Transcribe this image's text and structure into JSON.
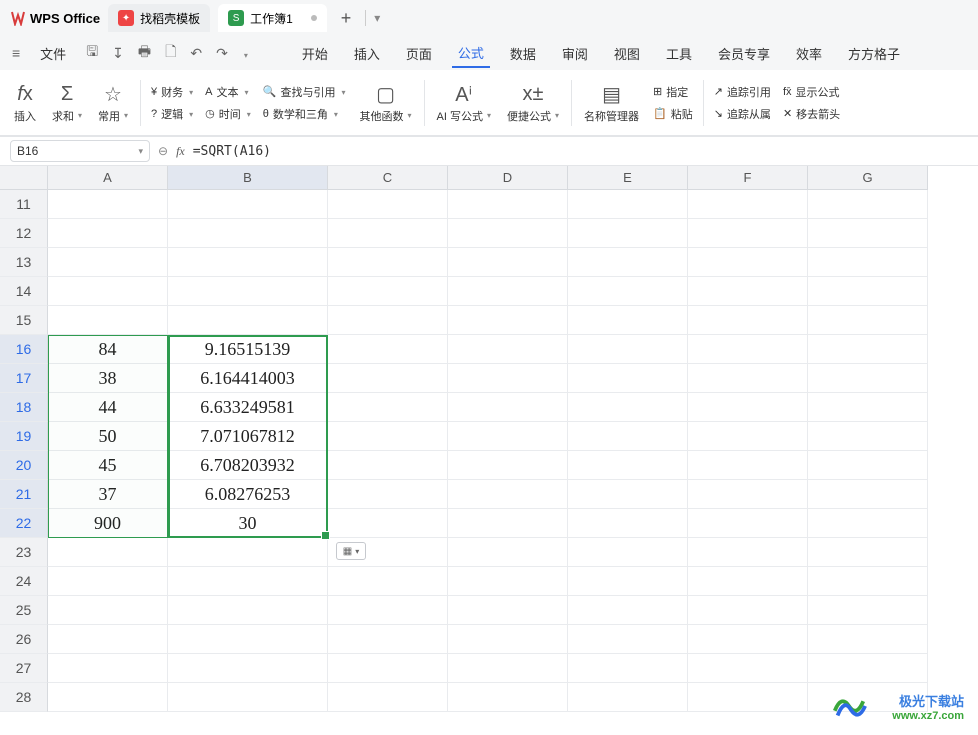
{
  "titlebar": {
    "app_name": "WPS Office",
    "tab1": "找稻壳模板",
    "tab2": "工作簿1"
  },
  "menubar": {
    "file": "文件",
    "items": [
      "开始",
      "插入",
      "页面",
      "公式",
      "数据",
      "审阅",
      "视图",
      "工具",
      "会员专享",
      "效率",
      "方方格子"
    ]
  },
  "ribbon": {
    "insert": "插入",
    "sum": "求和",
    "common": "常用",
    "finance": "财务",
    "text": "文本",
    "lookup": "查找与引用",
    "logic": "逻辑",
    "time": "时间",
    "math": "数学和三角",
    "other": "其他函数",
    "ai": "AI 写公式",
    "quick": "便捷公式",
    "name_mgr": "名称管理器",
    "assign": "指定",
    "paste": "粘贴",
    "trace_ref": "追踪引用",
    "trace_dep": "追踪从属",
    "show_formula": "显示公式",
    "remove_arrow": "移去箭头"
  },
  "namebox": {
    "ref": "B16"
  },
  "formula": {
    "text": "=SQRT(A16)"
  },
  "columns": [
    "A",
    "B",
    "C",
    "D",
    "E",
    "F",
    "G"
  ],
  "rows": [
    "11",
    "12",
    "13",
    "14",
    "15",
    "16",
    "17",
    "18",
    "19",
    "20",
    "21",
    "22",
    "23",
    "24",
    "25",
    "26",
    "27",
    "28"
  ],
  "dataA": {
    "16": "84",
    "17": "38",
    "18": "44",
    "19": "50",
    "20": "45",
    "21": "37",
    "22": "900"
  },
  "dataB": {
    "16": "9.16515139",
    "17": "6.164414003",
    "18": "6.633249581",
    "19": "7.071067812",
    "20": "6.708203932",
    "21": "6.08276253",
    "22": "30"
  },
  "watermark": {
    "l1": "极光下载站",
    "l2": "www.xz7.com"
  }
}
